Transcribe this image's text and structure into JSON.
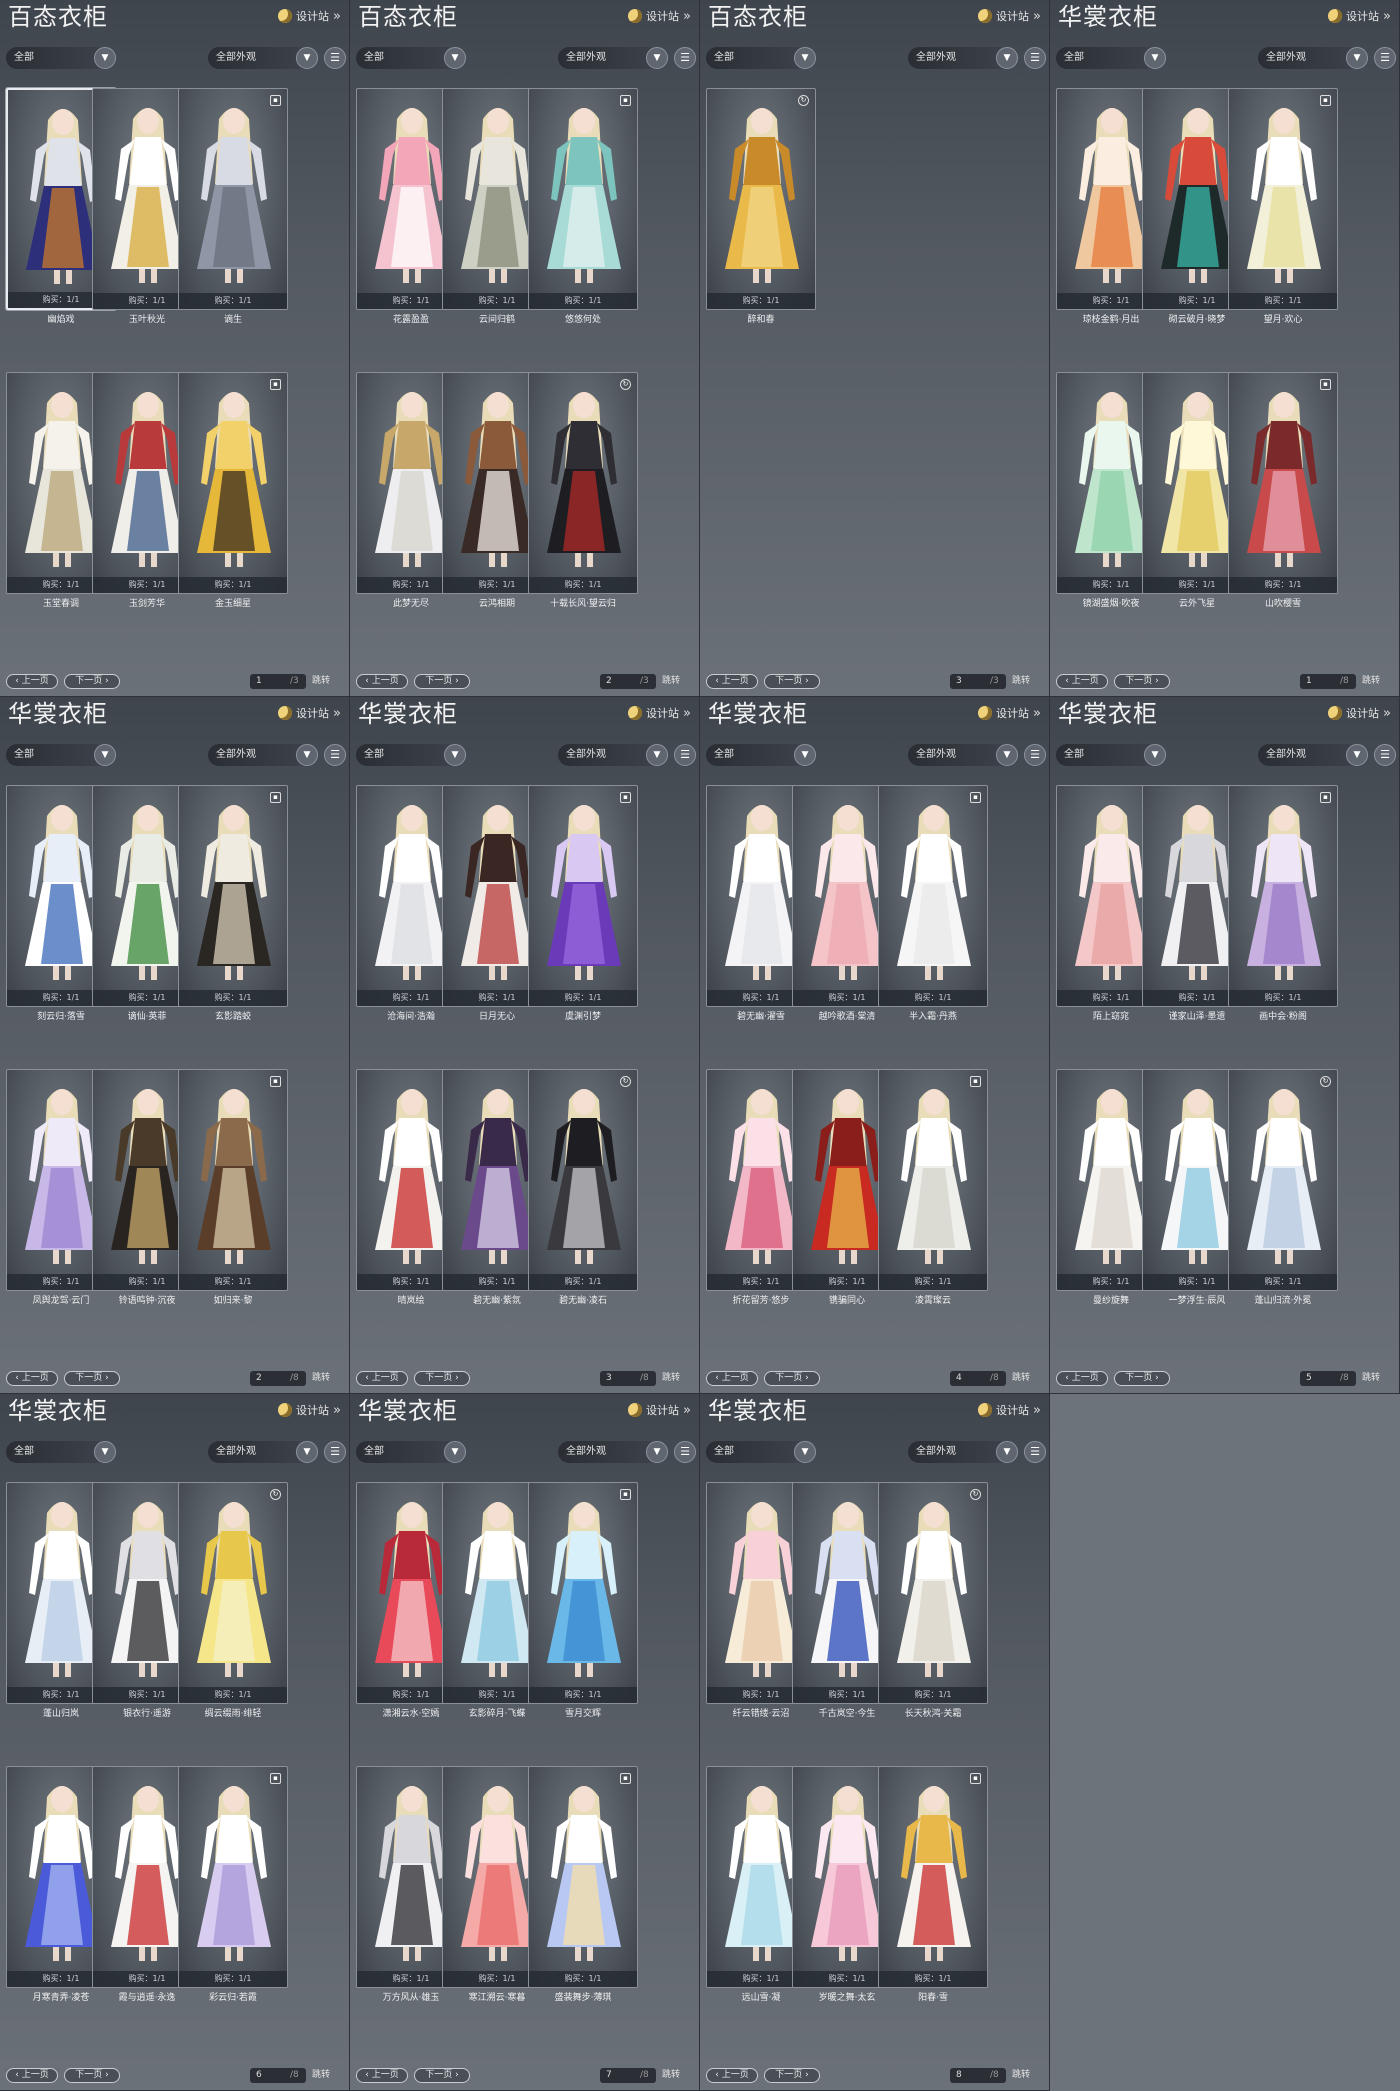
{
  "ui": {
    "design_label": "设计站",
    "filter_all": "全部",
    "filter_appearance": "全部外观",
    "prev_label": "上一页",
    "next_label": "下一页",
    "jump_label": "跳转",
    "buy_label": "购买：1/1"
  },
  "panels": [
    {
      "title": "百态衣柜",
      "page": "1",
      "total": "3",
      "items": [
        {
          "name": "幽焰戏",
          "badge": "lock",
          "selected": true,
          "palette": [
            "#2e2f7a",
            "#c97a2c",
            "#e0e2ea"
          ]
        },
        {
          "name": "玉叶秋光",
          "badge": "lock",
          "palette": [
            "#f2efe6",
            "#d7a93a",
            "#ffffff"
          ]
        },
        {
          "name": "谪生",
          "badge": "lock",
          "palette": [
            "#8f96a6",
            "#6b6f7c",
            "#d8dbe3"
          ]
        },
        {
          "name": "玉堂春调",
          "badge": "lock",
          "palette": [
            "#e8e5da",
            "#b9a678",
            "#f4f2ea"
          ]
        },
        {
          "name": "玉剑芳华",
          "badge": "lock",
          "palette": [
            "#f0eee8",
            "#3e5c8a",
            "#b83a3a"
          ]
        },
        {
          "name": "金玉细星",
          "badge": "lock",
          "palette": [
            "#e5b83a",
            "#3a2e22",
            "#f2d06a"
          ]
        }
      ]
    },
    {
      "title": "百态衣柜",
      "page": "2",
      "total": "3",
      "items": [
        {
          "name": "花露盈盈",
          "badge": "lock",
          "palette": [
            "#f4c3cf",
            "#ffffff",
            "#f2a6b8"
          ]
        },
        {
          "name": "云间归鹤",
          "badge": "lock",
          "palette": [
            "#cfd0c4",
            "#8a8c7a",
            "#e8e6dc"
          ]
        },
        {
          "name": "悠悠何处",
          "badge": "lock",
          "palette": [
            "#a8dbd6",
            "#e6f2f0",
            "#7cc4bd"
          ]
        },
        {
          "name": "此梦无尽",
          "badge": "lock",
          "palette": [
            "#eeeef0",
            "#d6d4cc",
            "#c8a86a"
          ]
        },
        {
          "name": "云鸿相期",
          "badge": "lock",
          "palette": [
            "#3a2a26",
            "#f0ebe3",
            "#8a5a3a"
          ]
        },
        {
          "name": "十载长风·望云归",
          "badge": "round",
          "palette": [
            "#1e1e22",
            "#b02a2a",
            "#2e2e34"
          ]
        }
      ]
    },
    {
      "title": "百态衣柜",
      "page": "3",
      "total": "3",
      "items": [
        {
          "name": "醉和春",
          "badge": "round",
          "palette": [
            "#e9b94a",
            "#f2d78a",
            "#c98a2a"
          ]
        }
      ]
    },
    {
      "title": "华裳衣柜",
      "page": "1",
      "total": "8",
      "items": [
        {
          "name": "琼枝金鹤·月出",
          "badge": "lock",
          "palette": [
            "#f0c8a0",
            "#e67a3a",
            "#fbeee0"
          ]
        },
        {
          "name": "砌云破月·晓梦",
          "badge": "lock",
          "palette": [
            "#1e2a2a",
            "#3ab8a8",
            "#d84a3a"
          ]
        },
        {
          "name": "望月·欢心",
          "badge": "lock",
          "palette": [
            "#f2f0d8",
            "#e6df9a",
            "#ffffff"
          ]
        },
        {
          "name": "镜湖盛烟·吹夜",
          "badge": "round",
          "palette": [
            "#bfe6cc",
            "#8ed0a8",
            "#eaf7ef"
          ]
        },
        {
          "name": "云外飞星",
          "badge": "lock",
          "palette": [
            "#f2e6a6",
            "#e0c85a",
            "#fff8d8"
          ]
        },
        {
          "name": "山吹樱雪",
          "badge": "lock",
          "palette": [
            "#c84a4a",
            "#e8a6b6",
            "#7a2a2a"
          ]
        }
      ]
    },
    {
      "title": "华裳衣柜",
      "page": "2",
      "total": "8",
      "items": [
        {
          "name": "刻云归·落雪",
          "badge": "lock",
          "palette": [
            "#ffffff",
            "#3a6ab8",
            "#e8eef8"
          ]
        },
        {
          "name": "谪仙·英菲",
          "badge": "lock",
          "palette": [
            "#f2f4ee",
            "#3a8a3a",
            "#e8ece4"
          ]
        },
        {
          "name": "玄影踏蛟",
          "badge": "lock",
          "palette": [
            "#2a2622",
            "#d8cdb8",
            "#f0ebe0"
          ]
        },
        {
          "name": "凤舆龙驾·云门",
          "badge": "lock",
          "palette": [
            "#c8b8e8",
            "#9a86d0",
            "#eeeaf8"
          ]
        },
        {
          "name": "铃语鸣钟·沉夜",
          "badge": "lock",
          "palette": [
            "#2a2420",
            "#c8a86a",
            "#4a3a2a"
          ]
        },
        {
          "name": "如归来·黎",
          "badge": "lock",
          "palette": [
            "#5a3e2a",
            "#d8c8a8",
            "#8a6a4a"
          ]
        }
      ]
    },
    {
      "title": "华裳衣柜",
      "page": "3",
      "total": "8",
      "items": [
        {
          "name": "沧海间·浩瀚",
          "badge": "round",
          "palette": [
            "#f2f2f4",
            "#dcdde2",
            "#ffffff"
          ]
        },
        {
          "name": "日月无心",
          "badge": "lock",
          "palette": [
            "#f0ebe6",
            "#b83a3a",
            "#3a2622"
          ]
        },
        {
          "name": "虞渊引梦",
          "badge": "lock",
          "palette": [
            "#6a3ab8",
            "#9a6ae0",
            "#d8c8f2"
          ]
        },
        {
          "name": "晴岚绘",
          "badge": "lock",
          "palette": [
            "#f4f2ee",
            "#c82a2a",
            "#ffffff"
          ]
        },
        {
          "name": "碧无幽·紫氛",
          "badge": "round",
          "palette": [
            "#6a4a8a",
            "#d8d0e8",
            "#3a2a4a"
          ]
        },
        {
          "name": "碧无幽·凌石",
          "badge": "round",
          "palette": [
            "#3a3a3e",
            "#c8c8cc",
            "#1e1e22"
          ]
        }
      ]
    },
    {
      "title": "华裳衣柜",
      "page": "4",
      "total": "8",
      "items": [
        {
          "name": "碧无幽·濯雪",
          "badge": "round",
          "palette": [
            "#f4f4f6",
            "#e4e6ea",
            "#ffffff"
          ]
        },
        {
          "name": "越吟歌酒·棠清",
          "badge": "lock",
          "palette": [
            "#f4c4c8",
            "#ecaab0",
            "#fbe8ea"
          ]
        },
        {
          "name": "半入霜·丹燕",
          "badge": "lock",
          "palette": [
            "#f6f6f6",
            "#e8e8ea",
            "#ffffff"
          ]
        },
        {
          "name": "折花留芳·悠步",
          "badge": "round",
          "palette": [
            "#f2b8c8",
            "#d85a7a",
            "#fbe0e8"
          ]
        },
        {
          "name": "镌骗同心",
          "badge": "lock",
          "palette": [
            "#c82a22",
            "#e8b84a",
            "#8a1e1a"
          ]
        },
        {
          "name": "凌霄璨云",
          "badge": "lock",
          "palette": [
            "#eeeeea",
            "#d4d4cc",
            "#ffffff"
          ]
        }
      ]
    },
    {
      "title": "华裳衣柜",
      "page": "5",
      "total": "8",
      "items": [
        {
          "name": "陌上窈窕",
          "badge": "lock",
          "palette": [
            "#f4c8c8",
            "#e8a0a0",
            "#fbeaea"
          ]
        },
        {
          "name": "谨家山泽·墨遗",
          "badge": "lock",
          "palette": [
            "#f0f0f2",
            "#2a2a30",
            "#d8d8dc"
          ]
        },
        {
          "name": "画中会·粉阁",
          "badge": "lock",
          "palette": [
            "#c8b0e0",
            "#9a7ac8",
            "#eee6f6"
          ]
        },
        {
          "name": "曼纱旋舞",
          "badge": "lock",
          "palette": [
            "#f6f4f0",
            "#dcd8d0",
            "#ffffff"
          ]
        },
        {
          "name": "一梦浮生·辰风",
          "badge": "lock",
          "palette": [
            "#f4f6f8",
            "#8ac8e0",
            "#ffffff"
          ]
        },
        {
          "name": "蓬山归流·外冕",
          "badge": "round",
          "palette": [
            "#e8eef6",
            "#b8c8e0",
            "#ffffff"
          ]
        }
      ]
    },
    {
      "title": "华裳衣柜",
      "page": "6",
      "total": "8",
      "items": [
        {
          "name": "蓬山归岚",
          "badge": "lock",
          "palette": [
            "#e8eef6",
            "#b8cce4",
            "#ffffff"
          ]
        },
        {
          "name": "银衣行·遥游",
          "badge": "lock",
          "palette": [
            "#f4f4f4",
            "#2a2a2e",
            "#e0e0e4"
          ]
        },
        {
          "name": "绸云缀雨·绯轻",
          "badge": "round",
          "palette": [
            "#f6e68a",
            "#f4f0c8",
            "#e8c84a"
          ]
        },
        {
          "name": "月寒青弄·凌苍",
          "badge": "round",
          "palette": [
            "#4a5ad8",
            "#a8b8f2",
            "#ffffff"
          ]
        },
        {
          "name": "霞与逍遥·永逸",
          "badge": "lock",
          "palette": [
            "#f6f4f2",
            "#c82a2a",
            "#ffffff"
          ]
        },
        {
          "name": "彩云归·若霞",
          "badge": "lock",
          "palette": [
            "#d8ccf0",
            "#a898d8",
            "#ffffff"
          ]
        }
      ]
    },
    {
      "title": "华裳衣柜",
      "page": "7",
      "total": "8",
      "items": [
        {
          "name": "潇湘云水·空嫣",
          "badge": "lock",
          "palette": [
            "#e84a5a",
            "#f6c8cc",
            "#b82a3a"
          ]
        },
        {
          "name": "玄影碎月·飞蝶",
          "badge": "lock",
          "palette": [
            "#cfe8f2",
            "#8ac8e0",
            "#ffffff"
          ]
        },
        {
          "name": "雪月交辉",
          "badge": "lock",
          "palette": [
            "#6ab8e8",
            "#3a8ad0",
            "#d8f0fa"
          ]
        },
        {
          "name": "万方风从·雄玉",
          "badge": "lock",
          "palette": [
            "#f0f0f2",
            "#2a2a2e",
            "#d8d8dc"
          ]
        },
        {
          "name": "寒江溯云·寒暮",
          "badge": "lock",
          "palette": [
            "#f6aaa8",
            "#e86a6a",
            "#fbe0de"
          ]
        },
        {
          "name": "盛装舞步·薄琪",
          "badge": "lock",
          "palette": [
            "#b8c8f2",
            "#f6e0a8",
            "#ffffff"
          ]
        }
      ]
    },
    {
      "title": "华裳衣柜",
      "page": "8",
      "total": "8",
      "items": [
        {
          "name": "纤云错缕·云沼",
          "badge": "lock",
          "palette": [
            "#f6ecd8",
            "#e8c8a8",
            "#f8d0d8"
          ]
        },
        {
          "name": "千古岚空·今生",
          "badge": "lock",
          "palette": [
            "#f6f6f8",
            "#2a4ab8",
            "#d8e0f2"
          ]
        },
        {
          "name": "长天秋鸿·关霜",
          "badge": "round",
          "palette": [
            "#f2f0ea",
            "#d8d4c8",
            "#ffffff"
          ]
        },
        {
          "name": "远山雪·凝",
          "badge": "lock",
          "palette": [
            "#d8f0f6",
            "#a8d8e8",
            "#ffffff"
          ]
        },
        {
          "name": "岁暖之舞·太玄",
          "badge": "lock",
          "palette": [
            "#f6c8d8",
            "#e89ab8",
            "#fbe8f0"
          ]
        },
        {
          "name": "阳春·雪",
          "badge": "lock",
          "palette": [
            "#f6f2ee",
            "#c82a2a",
            "#e8b84a"
          ]
        }
      ]
    }
  ]
}
